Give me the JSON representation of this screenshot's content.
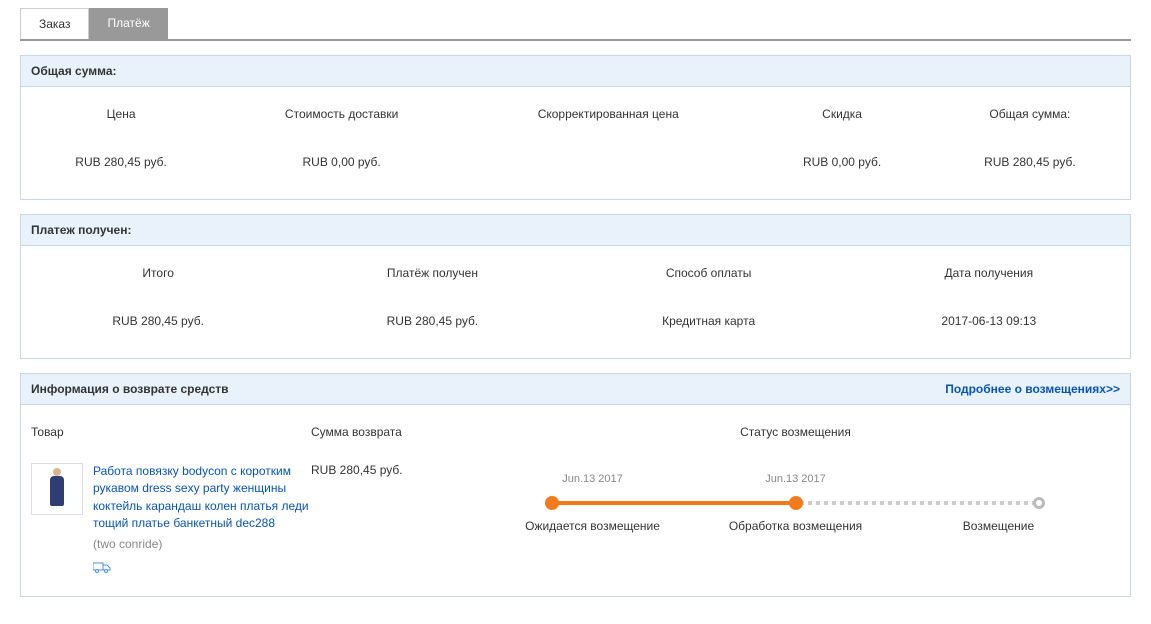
{
  "tabs": {
    "order": "Заказ",
    "payment": "Платёж"
  },
  "totals_panel": {
    "title": "Общая сумма:",
    "headers": {
      "price": "Цена",
      "shipping": "Стоимость доставки",
      "adjusted": "Скорректированная цена",
      "discount": "Скидка",
      "total": "Общая сумма:"
    },
    "values": {
      "price": "RUB 280,45 руб.",
      "shipping": "RUB 0,00 руб.",
      "adjusted": "",
      "discount": "RUB 0,00 руб.",
      "total": "RUB 280,45 руб."
    }
  },
  "received_panel": {
    "title": "Платеж получен:",
    "headers": {
      "total": "Итого",
      "received": "Платёж получен",
      "method": "Способ оплаты",
      "date": "Дата получения"
    },
    "values": {
      "total": "RUB 280,45 руб.",
      "received": "RUB 280,45 руб.",
      "method": "Кредитная карта",
      "date": "2017-06-13 09:13"
    }
  },
  "refund_panel": {
    "title": "Информация о возврате средств",
    "more_link": "Подробнее о возмещениях>>",
    "headers": {
      "product": "Товар",
      "amount": "Сумма возврата",
      "status": "Статус возмещения"
    },
    "item": {
      "name": "Работа повязку bodycon с коротким рукавом dress sexy party женщины коктейль карандаш колен платья леди тощий платье банкетный dec288",
      "store": "(two conride)",
      "amount": "RUB 280,45 руб."
    },
    "progress": {
      "dates": {
        "expected": "Jun.13 2017",
        "processing": "Jun.13 2017",
        "done": ""
      },
      "labels": {
        "expected": "Ожидается возмещение",
        "processing": "Обработка возмещения",
        "done": "Возмещение"
      }
    }
  }
}
